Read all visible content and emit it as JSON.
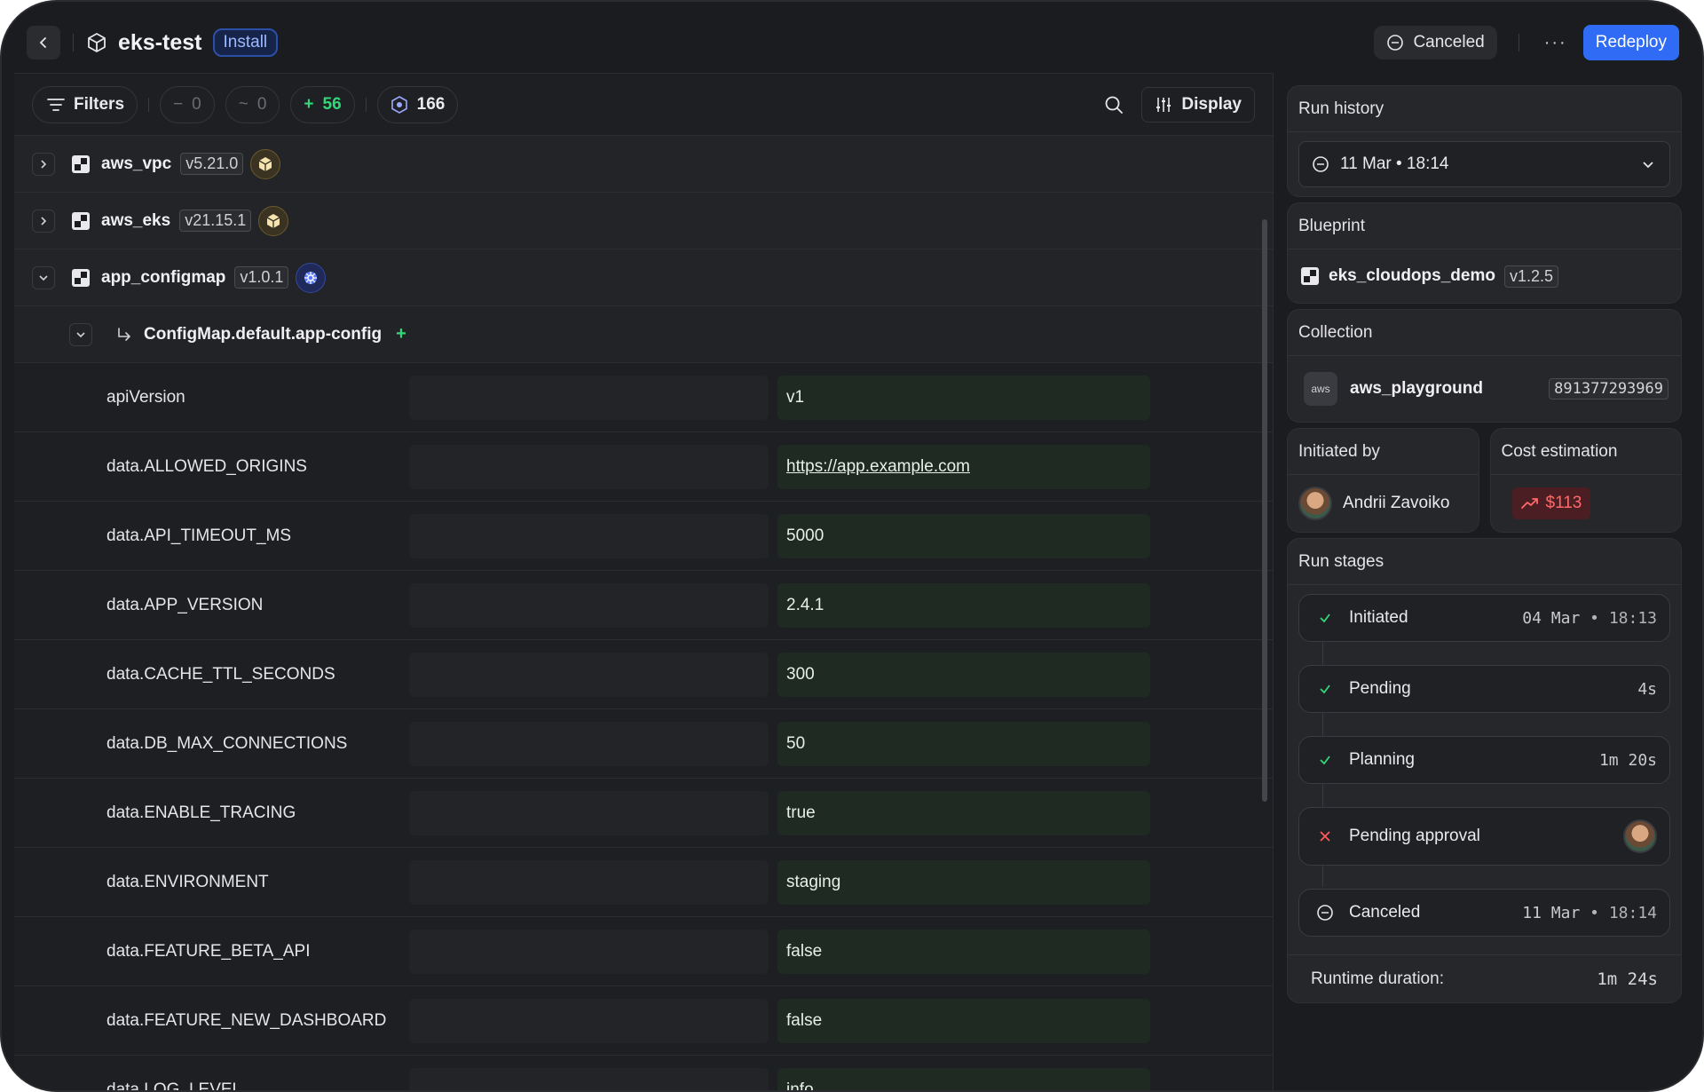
{
  "header": {
    "title": "eks-test",
    "badge": "Install",
    "status": "Canceled",
    "more": "···",
    "redeploy": "Redeploy"
  },
  "toolbar": {
    "filters": "Filters",
    "removed_count": "0",
    "changed_count": "0",
    "added_count": "56",
    "total_count": "166",
    "display": "Display"
  },
  "modules": [
    {
      "name": "aws_vpc",
      "version": "v5.21.0",
      "provider": "aws"
    },
    {
      "name": "aws_eks",
      "version": "v21.15.1",
      "provider": "aws"
    },
    {
      "name": "app_configmap",
      "version": "v1.0.1",
      "provider": "kubernetes"
    }
  ],
  "resource": {
    "name": "ConfigMap.default.app-config",
    "change": "+"
  },
  "attributes": [
    {
      "key": "apiVersion",
      "value": "v1"
    },
    {
      "key": "data.ALLOWED_ORIGINS",
      "value": "https://app.example.com"
    },
    {
      "key": "data.API_TIMEOUT_MS",
      "value": "5000"
    },
    {
      "key": "data.APP_VERSION",
      "value": "2.4.1"
    },
    {
      "key": "data.CACHE_TTL_SECONDS",
      "value": "300"
    },
    {
      "key": "data.DB_MAX_CONNECTIONS",
      "value": "50"
    },
    {
      "key": "data.ENABLE_TRACING",
      "value": "true"
    },
    {
      "key": "data.ENVIRONMENT",
      "value": "staging"
    },
    {
      "key": "data.FEATURE_BETA_API",
      "value": "false"
    },
    {
      "key": "data.FEATURE_NEW_DASHBOARD",
      "value": "false"
    },
    {
      "key": "data.LOG_LEVEL",
      "value": "info"
    }
  ],
  "sidebar": {
    "run_history": {
      "title": "Run history",
      "selected": "11 Mar • 18:14"
    },
    "blueprint": {
      "title": "Blueprint",
      "name": "eks_cloudops_demo",
      "version": "v1.2.5"
    },
    "collection": {
      "title": "Collection",
      "logo": "aws",
      "name": "aws_playground",
      "account": "891377293969"
    },
    "initiated_by": {
      "title": "Initiated by",
      "user": "Andrii Zavoiko"
    },
    "cost": {
      "title": "Cost estimation",
      "value": "$113"
    },
    "run_stages": {
      "title": "Run stages",
      "stages": [
        {
          "label": "Initiated",
          "status": "done",
          "time": "04 Mar",
          "time2": "18:13"
        },
        {
          "label": "Pending",
          "status": "done",
          "time": "4s"
        },
        {
          "label": "Planning",
          "status": "done",
          "time": "1m 20s"
        },
        {
          "label": "Pending approval",
          "status": "failed"
        },
        {
          "label": "Canceled",
          "status": "canceled",
          "time": "11 Mar",
          "time2": "18:14"
        }
      ],
      "runtime_label": "Runtime duration:",
      "runtime_value": "1m 24s"
    }
  },
  "colors": {
    "accent": "#2f6bf5",
    "added": "#34d67a",
    "danger": "#ff6a6a"
  }
}
